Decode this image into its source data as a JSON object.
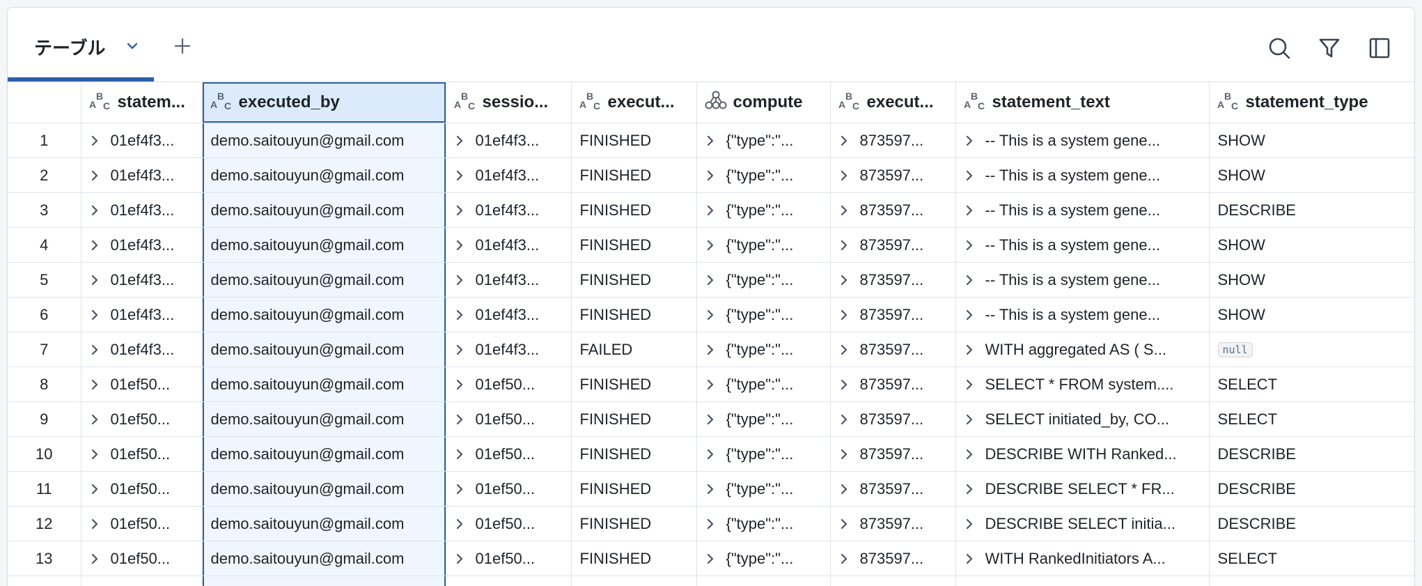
{
  "tab": {
    "label": "テーブル"
  },
  "columns": [
    {
      "key": "statement_id",
      "label": "statem...",
      "type_icon": "string-type-icon"
    },
    {
      "key": "executed_by",
      "label": "executed_by",
      "type_icon": "string-type-icon"
    },
    {
      "key": "session_id",
      "label": "sessio...",
      "type_icon": "string-type-icon"
    },
    {
      "key": "execution_status",
      "label": "execut...",
      "type_icon": "string-type-icon"
    },
    {
      "key": "compute",
      "label": "compute",
      "type_icon": "struct-type-icon"
    },
    {
      "key": "executed_by_user_id",
      "label": "execut...",
      "type_icon": "string-type-icon"
    },
    {
      "key": "statement_text",
      "label": "statement_text",
      "type_icon": "string-type-icon"
    },
    {
      "key": "statement_type",
      "label": "statement_type",
      "type_icon": "string-type-icon"
    }
  ],
  "rows": [
    {
      "num": "1",
      "statement_id": "01ef4f3...",
      "executed_by": "demo.saitouyun@gmail.com",
      "session_id": "01ef4f3...",
      "execution_status": "FINISHED",
      "compute": "{\"type\":\"...",
      "executed_by_user_id": "873597...",
      "statement_text": "-- This is a system gene...",
      "statement_type": "SHOW"
    },
    {
      "num": "2",
      "statement_id": "01ef4f3...",
      "executed_by": "demo.saitouyun@gmail.com",
      "session_id": "01ef4f3...",
      "execution_status": "FINISHED",
      "compute": "{\"type\":\"...",
      "executed_by_user_id": "873597...",
      "statement_text": "-- This is a system gene...",
      "statement_type": "SHOW"
    },
    {
      "num": "3",
      "statement_id": "01ef4f3...",
      "executed_by": "demo.saitouyun@gmail.com",
      "session_id": "01ef4f3...",
      "execution_status": "FINISHED",
      "compute": "{\"type\":\"...",
      "executed_by_user_id": "873597...",
      "statement_text": "-- This is a system gene...",
      "statement_type": "DESCRIBE"
    },
    {
      "num": "4",
      "statement_id": "01ef4f3...",
      "executed_by": "demo.saitouyun@gmail.com",
      "session_id": "01ef4f3...",
      "execution_status": "FINISHED",
      "compute": "{\"type\":\"...",
      "executed_by_user_id": "873597...",
      "statement_text": "-- This is a system gene...",
      "statement_type": "SHOW"
    },
    {
      "num": "5",
      "statement_id": "01ef4f3...",
      "executed_by": "demo.saitouyun@gmail.com",
      "session_id": "01ef4f3...",
      "execution_status": "FINISHED",
      "compute": "{\"type\":\"...",
      "executed_by_user_id": "873597...",
      "statement_text": "-- This is a system gene...",
      "statement_type": "SHOW"
    },
    {
      "num": "6",
      "statement_id": "01ef4f3...",
      "executed_by": "demo.saitouyun@gmail.com",
      "session_id": "01ef4f3...",
      "execution_status": "FINISHED",
      "compute": "{\"type\":\"...",
      "executed_by_user_id": "873597...",
      "statement_text": "-- This is a system gene...",
      "statement_type": "SHOW"
    },
    {
      "num": "7",
      "statement_id": "01ef4f3...",
      "executed_by": "demo.saitouyun@gmail.com",
      "session_id": "01ef4f3...",
      "execution_status": "FAILED",
      "compute": "{\"type\":\"...",
      "executed_by_user_id": "873597...",
      "statement_text": "WITH aggregated AS ( S...",
      "statement_type": null
    },
    {
      "num": "8",
      "statement_id": "01ef50...",
      "executed_by": "demo.saitouyun@gmail.com",
      "session_id": "01ef50...",
      "execution_status": "FINISHED",
      "compute": "{\"type\":\"...",
      "executed_by_user_id": "873597...",
      "statement_text": "SELECT * FROM system....",
      "statement_type": "SELECT"
    },
    {
      "num": "9",
      "statement_id": "01ef50...",
      "executed_by": "demo.saitouyun@gmail.com",
      "session_id": "01ef50...",
      "execution_status": "FINISHED",
      "compute": "{\"type\":\"...",
      "executed_by_user_id": "873597...",
      "statement_text": "SELECT initiated_by, CO...",
      "statement_type": "SELECT"
    },
    {
      "num": "10",
      "statement_id": "01ef50...",
      "executed_by": "demo.saitouyun@gmail.com",
      "session_id": "01ef50...",
      "execution_status": "FINISHED",
      "compute": "{\"type\":\"...",
      "executed_by_user_id": "873597...",
      "statement_text": "DESCRIBE WITH Ranked...",
      "statement_type": "DESCRIBE"
    },
    {
      "num": "11",
      "statement_id": "01ef50...",
      "executed_by": "demo.saitouyun@gmail.com",
      "session_id": "01ef50...",
      "execution_status": "FINISHED",
      "compute": "{\"type\":\"...",
      "executed_by_user_id": "873597...",
      "statement_text": "DESCRIBE SELECT * FR...",
      "statement_type": "DESCRIBE"
    },
    {
      "num": "12",
      "statement_id": "01ef50...",
      "executed_by": "demo.saitouyun@gmail.com",
      "session_id": "01ef50...",
      "execution_status": "FINISHED",
      "compute": "{\"type\":\"...",
      "executed_by_user_id": "873597...",
      "statement_text": "DESCRIBE SELECT initia...",
      "statement_type": "DESCRIBE"
    },
    {
      "num": "13",
      "statement_id": "01ef50...",
      "executed_by": "demo.saitouyun@gmail.com",
      "session_id": "01ef50...",
      "execution_status": "FINISHED",
      "compute": "{\"type\":\"...",
      "executed_by_user_id": "873597...",
      "statement_text": "WITH RankedInitiators A...",
      "statement_type": "SELECT"
    },
    {
      "num": "",
      "statement_id": "",
      "executed_by": "",
      "session_id": "",
      "execution_status": "",
      "compute": "",
      "executed_by_user_id": "",
      "statement_text": "",
      "statement_type": ""
    }
  ],
  "null_label": "null",
  "expandable_columns": [
    "statement_id",
    "session_id",
    "compute",
    "executed_by_user_id",
    "statement_text"
  ],
  "selected_column": "executed_by",
  "colors": {
    "accent": "#2c5fa8",
    "selected_bg": "#f0f6fd",
    "header_selected_bg": "#dcebfb"
  }
}
